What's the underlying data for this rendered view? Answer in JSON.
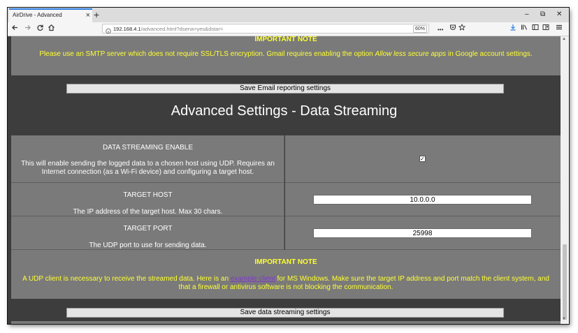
{
  "browser": {
    "tab_title": "AirDrive - Advanced",
    "tab_close": "×",
    "new_tab": "+",
    "url_host": "192.168.4.1",
    "url_path": "/advanced.html?dsena=yes&dstar=",
    "zoom": "60%",
    "more": "•••",
    "win_min": "–",
    "win_max": "⧉",
    "win_close": "✕"
  },
  "email_note": {
    "heading": "IMPORTANT NOTE",
    "text_before": "Please use an SMTP server which does not require SSL/TLS encryption. Gmail requires enabling the option ",
    "text_italic": "Allow less secure apps",
    "text_after": " in Google account settings."
  },
  "email_save_button": "Save Email reporting settings",
  "section_title": "Advanced Settings - Data Streaming",
  "streaming_enable": {
    "label": "DATA STREAMING ENABLE",
    "description": "This will enable sending the logged data to a chosen host using UDP. Requires an Internet connection (as a Wi-Fi device) and configuring a target host.",
    "checked": true,
    "check_glyph": "✓"
  },
  "target_host": {
    "label": "TARGET HOST",
    "description": "The IP address of the target host. Max 30 chars.",
    "value": "10.0.0.0"
  },
  "target_port": {
    "label": "TARGET PORT",
    "description": "The UDP port to use for sending data.",
    "value": "25998"
  },
  "streaming_note": {
    "heading": "IMPORTANT NOTE",
    "text_before": "A UDP client is necessary to receive the streamed data. Here is an ",
    "link": "example client",
    "text_after": " for MS Windows. Make sure the target IP address and port match the client system, and that a firewall or antivirus software is not blocking the communication."
  },
  "streaming_save_button": "Save data streaming settings"
}
